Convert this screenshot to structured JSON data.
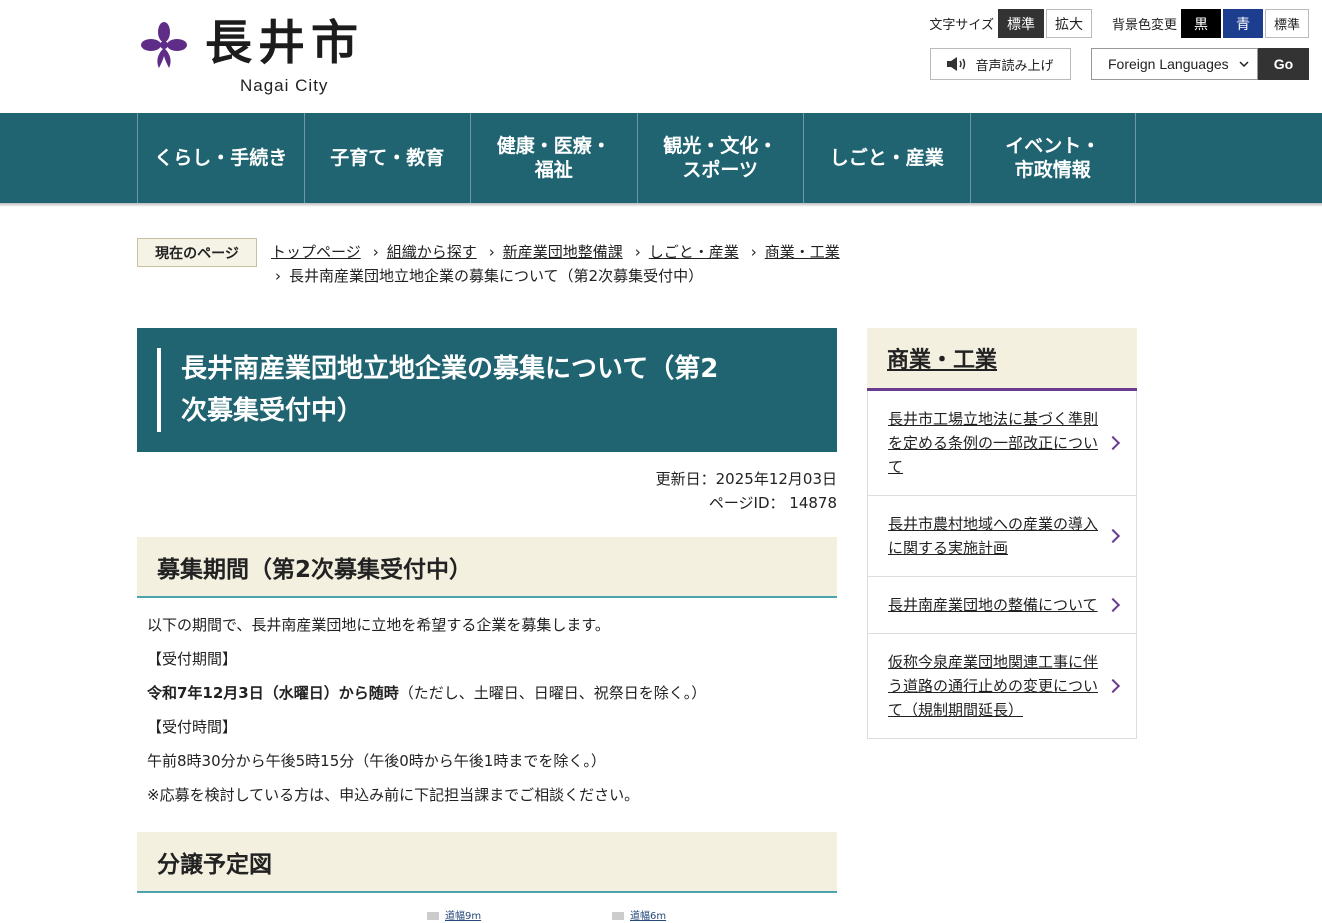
{
  "header": {
    "logo_title": "長井市",
    "logo_sub": "Nagai City",
    "font_size_label": "文字サイズ",
    "font_size_standard": "標準",
    "font_size_large": "拡大",
    "bg_color_label": "背景色変更",
    "bg_black": "黒",
    "bg_blue": "青",
    "bg_standard": "標準",
    "read_aloud": "音声読み上げ",
    "language_select": "Foreign Languages",
    "go": "Go"
  },
  "nav": [
    {
      "line1": "くらし・手続き",
      "line2": ""
    },
    {
      "line1": "子育て・教育",
      "line2": ""
    },
    {
      "line1": "健康・医療・",
      "line2": "福祉"
    },
    {
      "line1": "観光・文化・",
      "line2": "スポーツ"
    },
    {
      "line1": "しごと・産業",
      "line2": ""
    },
    {
      "line1": "イベント・",
      "line2": "市政情報"
    }
  ],
  "breadcrumb": {
    "label": "現在のページ",
    "items": [
      "トップページ",
      "組織から探す",
      "新産業団地整備課",
      "しごと・産業",
      "商業・工業"
    ],
    "current": "長井南産業団地立地企業の募集について（第2次募集受付中）"
  },
  "main": {
    "title": "長井南産業団地立地企業の募集について（第2次募集受付中）",
    "title_line1": "長井南産業団地立地企業の募集について（第2",
    "title_line2": "次募集受付中）",
    "updated": "更新日：2025年12月03日",
    "page_id": "ページID： 14878",
    "section1_heading": "募集期間（第2次募集受付中）",
    "para1": "以下の期間で、長井南産業団地に立地を希望する企業を募集します。",
    "reception_period_label": "【受付期間】",
    "reception_period_bold": "令和7年12月3日（水曜日）から随時",
    "reception_period_note": "（ただし、土曜日、日曜日、祝祭日を除く。）",
    "reception_time_label": "【受付時間】",
    "reception_time": "午前8時30分から午後5時15分（午後0時から午後1時までを除く。）",
    "consult_note": "※応募を検討している方は、申込み前に下記担当課までご相談ください。",
    "section2_heading": "分譲予定図",
    "map_label1": "道幅9m",
    "map_label2": "道幅6m"
  },
  "sidebar": {
    "heading": "商業・工業",
    "items": [
      "長井市工場立地法に基づく準則を定める条例の一部改正について",
      "長井市農村地域への産業の導入に関する実施計画",
      "長井南産業団地の整備について",
      "仮称今泉産業団地関連工事に伴う道路の通行止めの変更について（規制期間延長）"
    ]
  },
  "colors": {
    "nav_bg": "#1f6470",
    "accent_purple": "#6a3b8f",
    "heading_bg": "#f3f0e0",
    "heading_border": "#4ba3ad"
  }
}
